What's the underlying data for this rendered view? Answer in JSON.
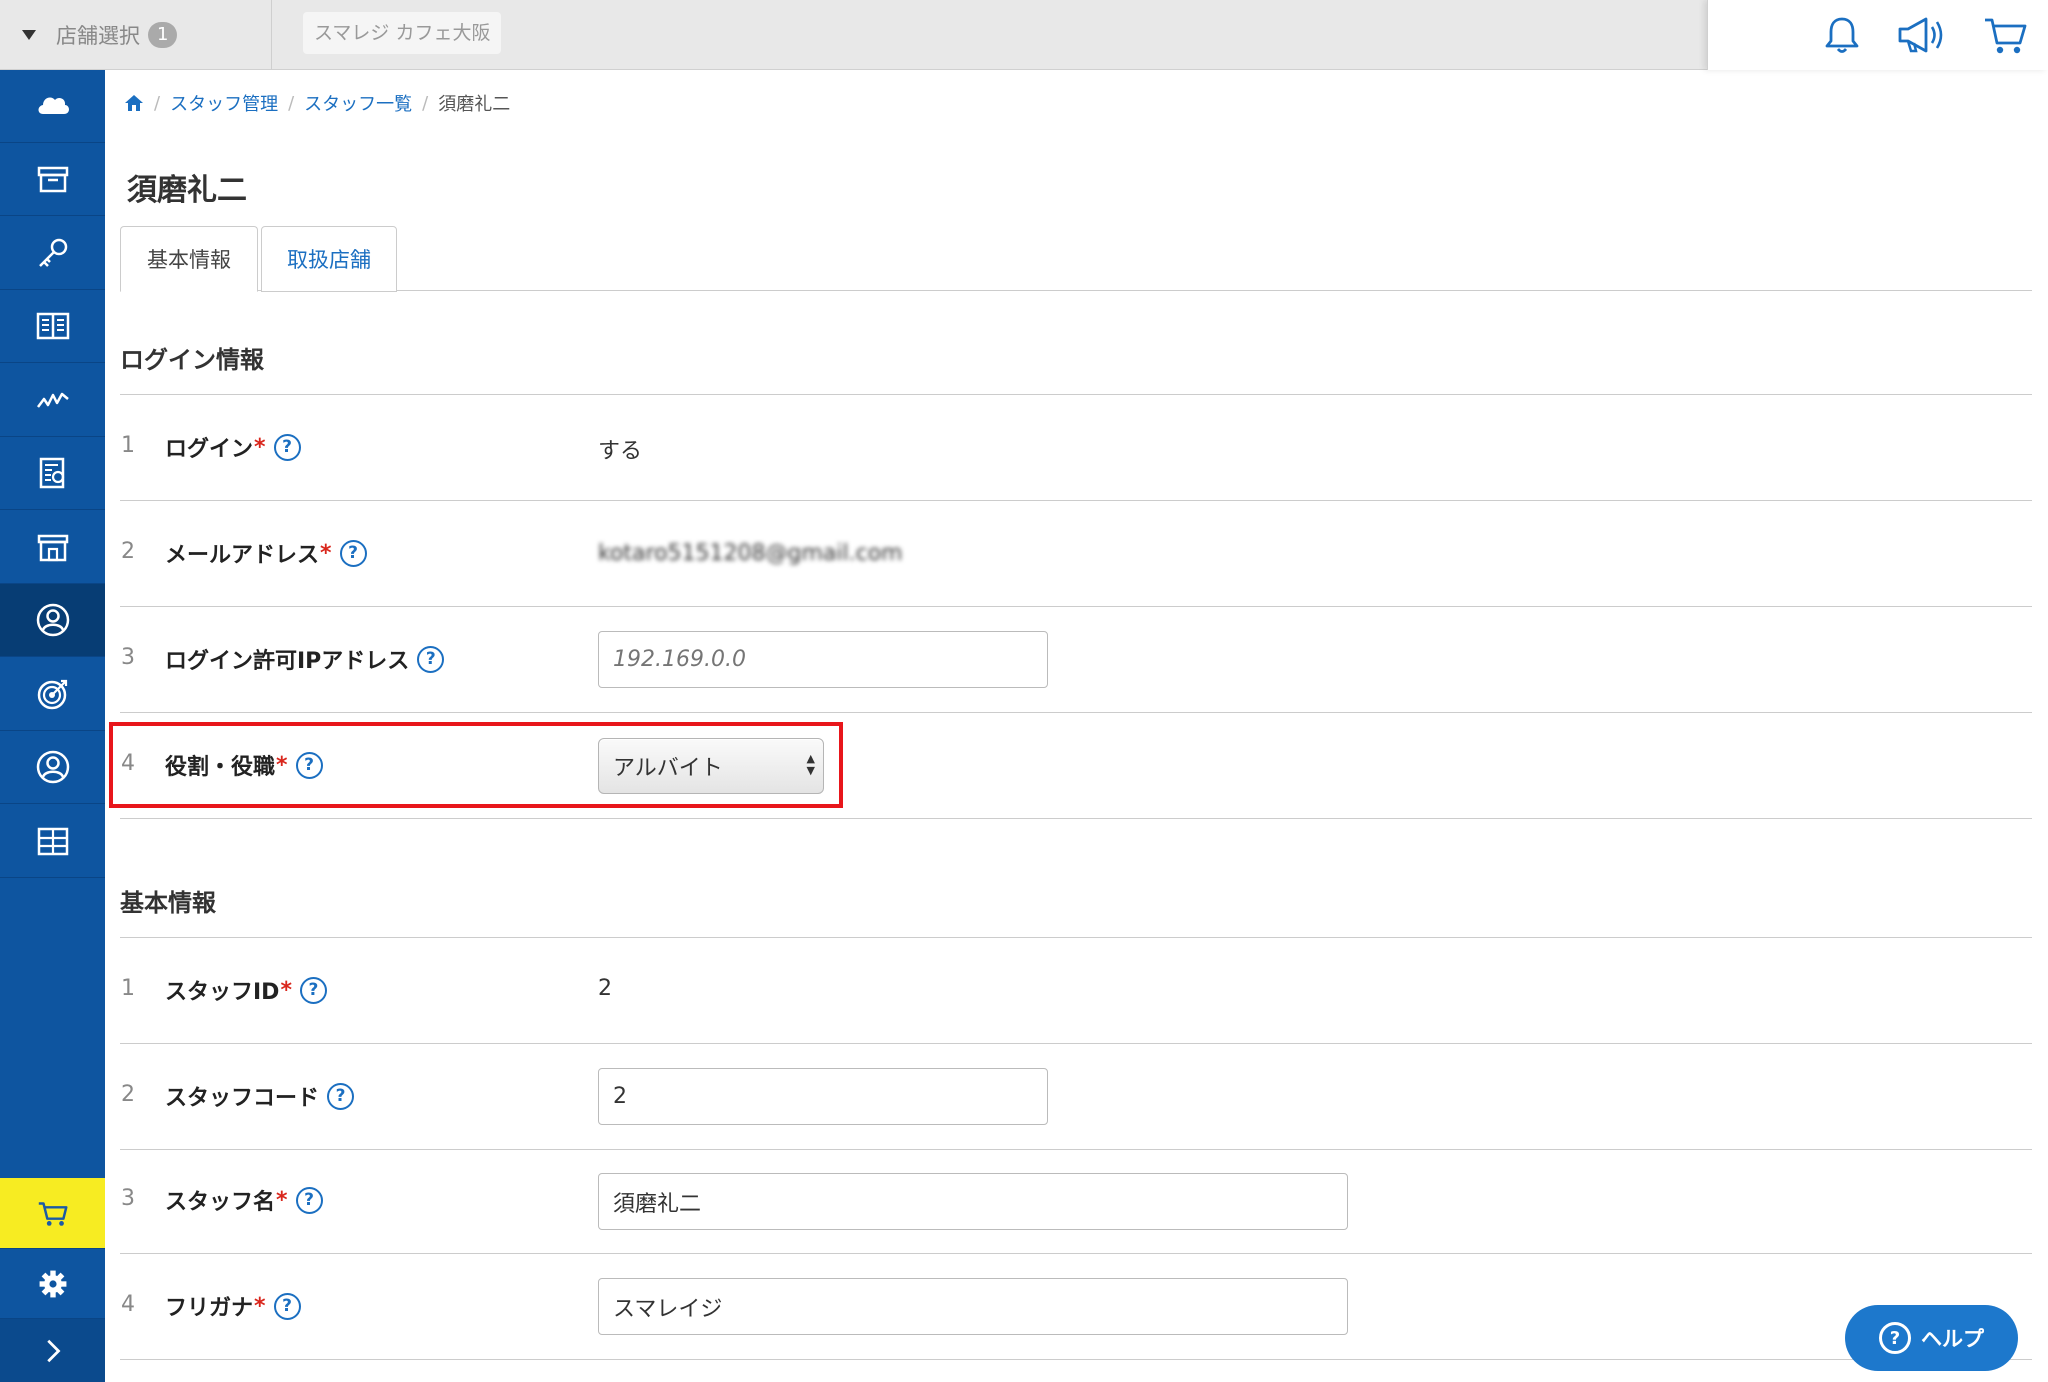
{
  "topbar": {
    "store_select_label": "店舗選択",
    "store_count": "1",
    "current_store": "スマレジ カフェ大阪",
    "icons": [
      "bell-icon",
      "megaphone-icon",
      "cart-icon"
    ]
  },
  "sidebar": {
    "items": [
      "cloud-icon",
      "archive-icon",
      "key-icon",
      "book-icon",
      "chart-icon",
      "report-icon",
      "store-icon",
      "user-icon",
      "target-icon",
      "customer-icon",
      "grid-icon"
    ],
    "active_index": 7,
    "bottom": [
      "cart-icon",
      "gear-icon",
      "chevron-right-icon"
    ],
    "cart_color": "#f7ec22",
    "accent": "#0e55a0"
  },
  "breadcrumb": {
    "items": [
      "スタッフ管理",
      "スタッフ一覧"
    ],
    "current": "須磨礼二"
  },
  "page_title": "須磨礼二",
  "tabs": [
    {
      "label": "基本情報",
      "active": true
    },
    {
      "label": "取扱店舗",
      "active": false
    }
  ],
  "login_section": {
    "title": "ログイン情報",
    "rows": [
      {
        "num": "1",
        "label": "ログイン",
        "required": true,
        "value": "する"
      },
      {
        "num": "2",
        "label": "メールアドレス",
        "required": true,
        "value": "kotaro5151208@gmail.com"
      },
      {
        "num": "3",
        "label": "ログイン許可IPアドレス",
        "required": false,
        "placeholder": "192.169.0.0"
      },
      {
        "num": "4",
        "label": "役割・役職",
        "required": true,
        "selected": "アルバイト"
      }
    ]
  },
  "basic_section": {
    "title": "基本情報",
    "rows": [
      {
        "num": "1",
        "label": "スタッフID",
        "required": true,
        "value": "2"
      },
      {
        "num": "2",
        "label": "スタッフコード",
        "required": false,
        "value": "2"
      },
      {
        "num": "3",
        "label": "スタッフ名",
        "required": true,
        "value": "須磨礼二"
      },
      {
        "num": "4",
        "label": "フリガナ",
        "required": true,
        "value": "スマレイジ"
      }
    ]
  },
  "required_mark": "*",
  "help_mark": "?",
  "help_button": {
    "label": "ヘルプ"
  }
}
